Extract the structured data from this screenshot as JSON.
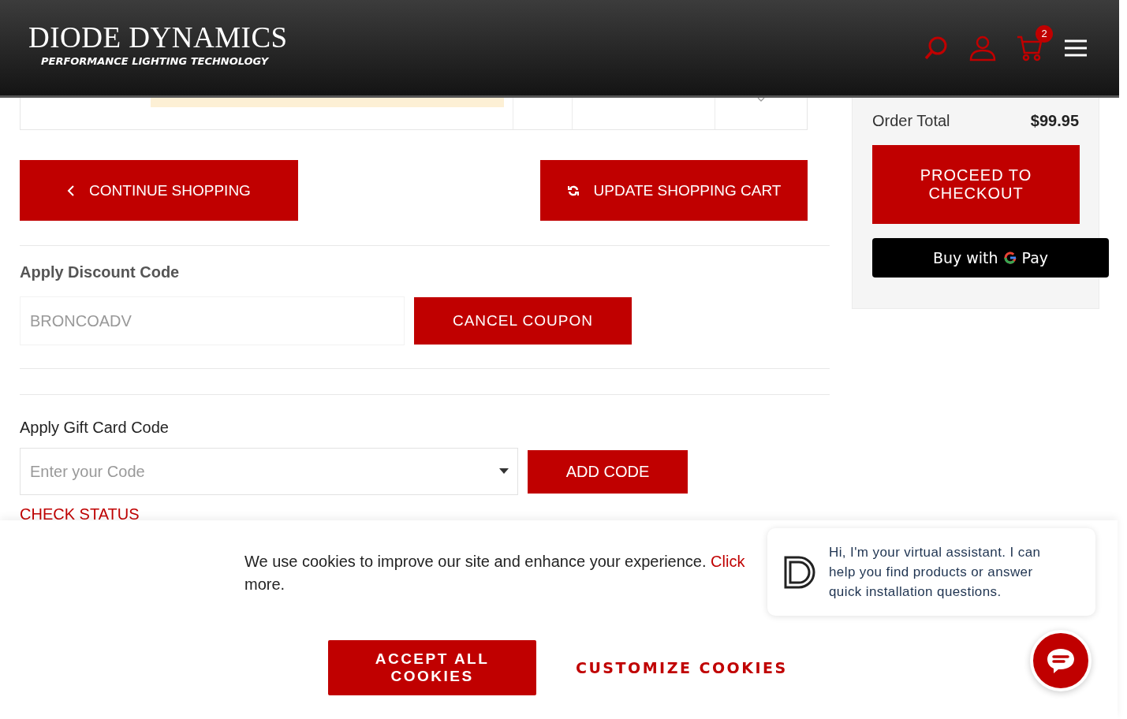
{
  "header": {
    "logo": "DIODE DYNAMICS",
    "tagline": "PERFORMANCE LIGHTING TECHNOLOGY",
    "cart_count": "2"
  },
  "actions": [
    {
      "label": "CONTINUE SHOPPING",
      "kind": "back"
    },
    {
      "label": "UPDATE SHOPPING CART",
      "kind": "refresh"
    }
  ],
  "discount": {
    "title": "Apply Discount Code",
    "value": "BRONCOADV",
    "button": "CANCEL COUPON"
  },
  "gift_card": {
    "title": "Apply Gift Card Code",
    "placeholder": "Enter your Code",
    "button": "ADD CODE",
    "link": "CHECK STATUS"
  },
  "summary": {
    "label": "Order Total",
    "value": "$99.95",
    "checkout": "PROCEED TO CHECKOUT",
    "gpay_prefix": "Buy with",
    "gpay_suffix": "Pay"
  },
  "cookie": {
    "text": "We use cookies to improve our site and enhance your experience.",
    "link": "Click",
    "tail": "more.",
    "accept": "ACCEPT ALL COOKIES",
    "customize": "CUSTOMIZE COOKIES"
  },
  "chat": {
    "message": "Hi, I'm your virtual assistant. I can help you find products or answer quick installation questions."
  }
}
